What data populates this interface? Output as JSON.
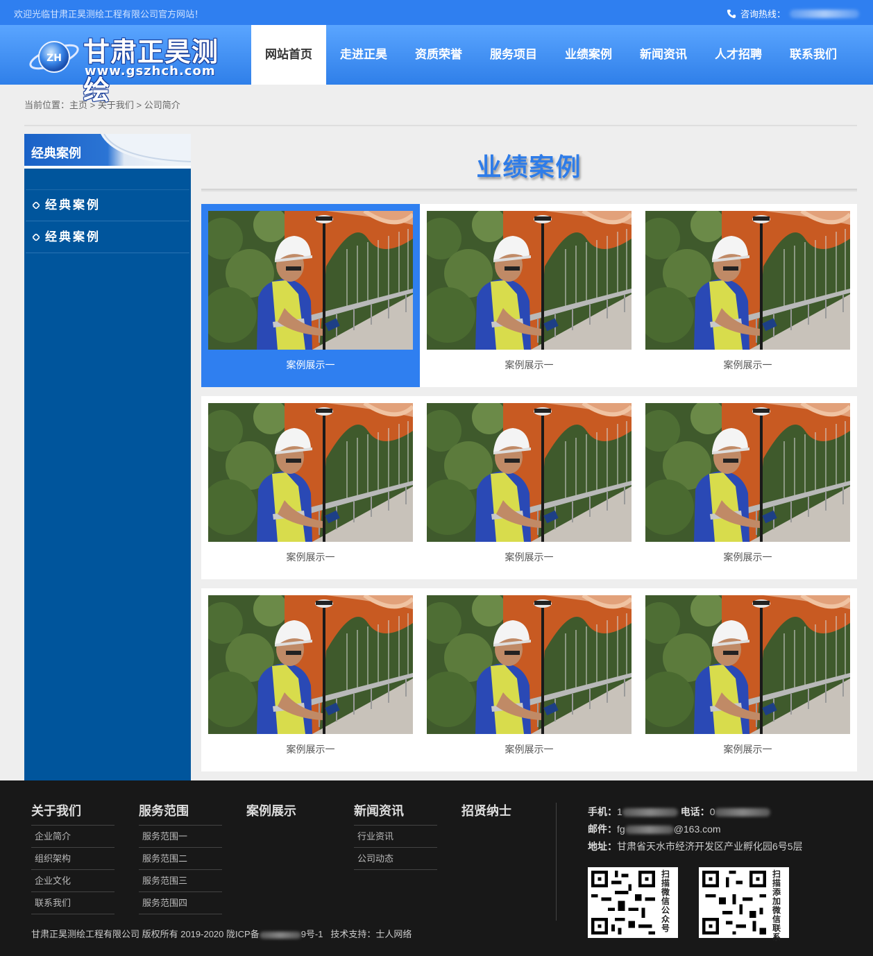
{
  "topbar": {
    "welcome": "欢迎光临甘肃正昊测绘工程有限公司官方网站！",
    "hotline_label": "咨询热线："
  },
  "header": {
    "logo_initials": "ZH",
    "logo_title": "甘肃正昊测绘",
    "logo_url": "www.gszhch.com",
    "nav": [
      "网站首页",
      "走进正昊",
      "资质荣誉",
      "服务项目",
      "业绩案例",
      "新闻资讯",
      "人才招聘",
      "联系我们"
    ],
    "active_index": 0
  },
  "breadcrumb": {
    "label": "当前位置：",
    "items": [
      "主页",
      "关于我们",
      "公司简介"
    ],
    "separator": ">"
  },
  "sidebar": {
    "title": "经典案例",
    "items": [
      "经典案例",
      "经典案例"
    ]
  },
  "main": {
    "title": "业绩案例",
    "cases": [
      {
        "label": "案例展示一"
      },
      {
        "label": "案例展示一"
      },
      {
        "label": "案例展示一"
      },
      {
        "label": "案例展示一"
      },
      {
        "label": "案例展示一"
      },
      {
        "label": "案例展示一"
      },
      {
        "label": "案例展示一"
      },
      {
        "label": "案例展示一"
      },
      {
        "label": "案例展示一"
      }
    ],
    "selected_index": 0
  },
  "footer": {
    "columns": [
      {
        "title": "关于我们",
        "links": [
          "企业简介",
          "组织架构",
          "企业文化",
          "联系我们"
        ]
      },
      {
        "title": "服务范围",
        "links": [
          "服务范围一",
          "服务范围二",
          "服务范围三",
          "服务范围四"
        ]
      },
      {
        "title": "案例展示",
        "links": []
      },
      {
        "title": "新闻资讯",
        "links": [
          "行业资讯",
          "公司动态"
        ]
      },
      {
        "title": "招贤纳士",
        "links": []
      }
    ],
    "contact": {
      "mobile_label": "手机：",
      "mobile_prefix": "1",
      "phone_label": "电话：",
      "phone_prefix": "0",
      "email_label": "邮件：",
      "email_prefix": "fg",
      "email_suffix": "@163.com",
      "address_label": "地址：",
      "address": "甘肃省天水市经济开发区产业孵化园6号5层"
    },
    "qr": [
      {
        "caption": "扫描微信公众号"
      },
      {
        "caption": "扫描添加微信联系"
      }
    ],
    "copyright_pre": "甘肃正昊测绘工程有限公司 版权所有 2019-2020 陇ICP备",
    "copyright_post": "9号-1",
    "tech_support": "技术支持：士人网络"
  },
  "colors": {
    "brand_blue": "#2f7ff0",
    "sidebar_blue": "#00559c",
    "footer_bg": "#181818"
  }
}
